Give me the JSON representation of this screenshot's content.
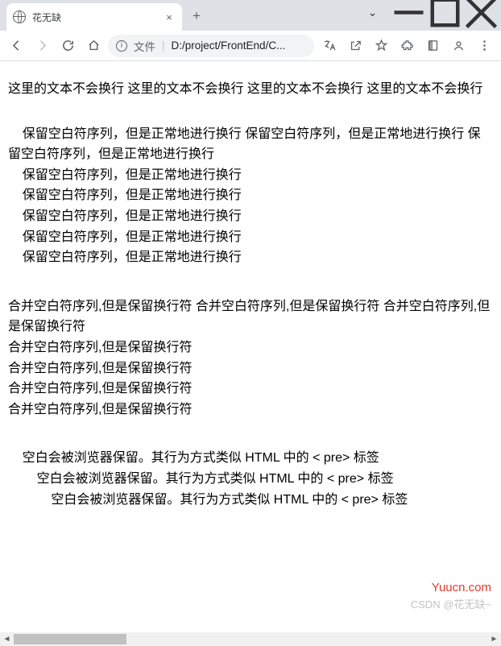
{
  "window": {
    "tab_title": "花无缺",
    "close_tab": "×",
    "new_tab": "+",
    "controls": {
      "chevron": "⌄",
      "min": "—",
      "max": "☐",
      "close": "✕"
    }
  },
  "toolbar": {
    "info_glyph": "i",
    "file_label": "文件",
    "sep": "|",
    "url": "D:/project/FrontEnd/C..."
  },
  "content": {
    "nowrap": "这里的文本不会换行 这里的文本不会换行 这里的文本不会换行 这里的文本不会换行",
    "prewrap": "    保留空白符序列，但是正常地进行换行 保留空白符序列，但是正常地进行换行 保留空白符序列，但是正常地进行换行\n    保留空白符序列，但是正常地进行换行\n    保留空白符序列，但是正常地进行换行\n    保留空白符序列，但是正常地进行换行\n    保留空白符序列，但是正常地进行换行\n    保留空白符序列，但是正常地进行换行",
    "preline": "合并空白符序列,但是保留换行符 合并空白符序列,但是保留换行符 合并空白符序列,但是保留换行符\n合并空白符序列,但是保留换行符\n合并空白符序列,但是保留换行符\n合并空白符序列,但是保留换行符\n合并空白符序列,但是保留换行符",
    "pre": "    空白会被浏览器保留。其行为方式类似 HTML 中的 < pre> 标签\n        空白会被浏览器保留。其行为方式类似 HTML 中的 < pre> 标签\n            空白会被浏览器保留。其行为方式类似 HTML 中的 < pre> 标签"
  },
  "watermark": {
    "site": "Yuucn.com",
    "author": "CSDN @花无缺~"
  }
}
